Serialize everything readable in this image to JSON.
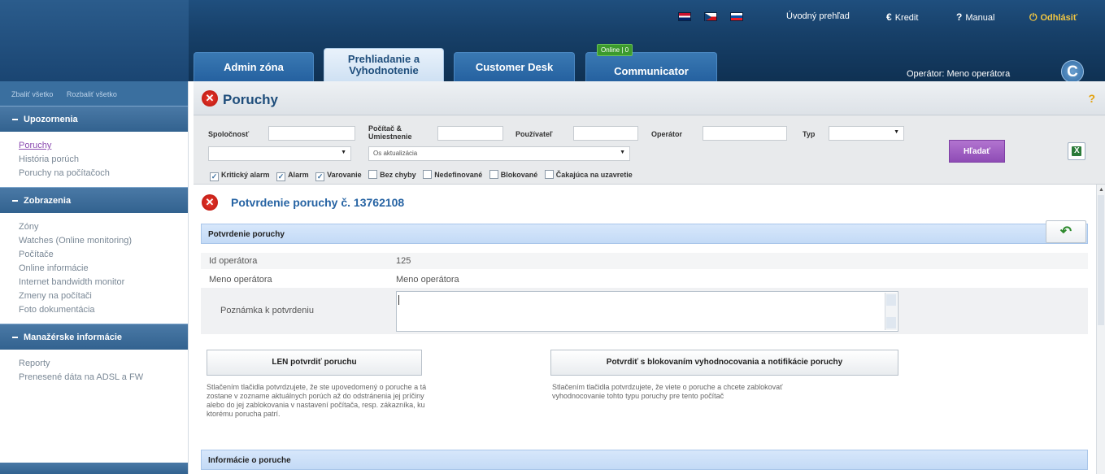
{
  "header": {
    "flags": [
      "uk-flag",
      "cz-flag",
      "sk-flag"
    ],
    "links": {
      "overview": "Úvodný prehľad",
      "credit_icon": "€",
      "credit": "Kredit",
      "manual_icon": "?",
      "manual": "Manual",
      "logout_icon": "⏻",
      "logout": "Odhlásiť"
    },
    "tabs": [
      {
        "label": "Admin zóna"
      },
      {
        "label_line1": "Prehliadanie a",
        "label_line2": "Vyhodnotenie"
      },
      {
        "label": "Customer Desk"
      },
      {
        "label": "Communicator"
      }
    ],
    "online_badge": "Online | 0",
    "operator_label": "Operátor: Meno operátora",
    "logo_letter": "C"
  },
  "sidebar": {
    "collapse_all": "Zbaliť všetko",
    "expand_all": "Rozbaliť všetko",
    "sections": [
      {
        "title": "Upozornenia",
        "items": [
          "Poruchy",
          "História porúch",
          "Poruchy na počítačoch"
        ]
      },
      {
        "title": "Zobrazenia",
        "items": [
          "Zóny",
          "Watches (Online monitoring)",
          "Počítače",
          "Online informácie",
          "Internet bandwidth monitor",
          "Zmeny na počítači",
          "Foto dokumentácia"
        ]
      },
      {
        "title": "Manažérske informácie",
        "items": [
          "Reporty",
          "Prenesené dáta na ADSL a FW"
        ]
      }
    ]
  },
  "page": {
    "title": "Poruchy",
    "help": "?"
  },
  "filter": {
    "company_label": "Spoločnosť",
    "computer_label_1": "Počítač &",
    "computer_label_2": "Umiestnenie",
    "user_label": "Používateľ",
    "operator_label": "Operátor",
    "type_label": "Typ",
    "time_select": "Os aktualizácia",
    "search_button": "Hľadať",
    "checkboxes": [
      {
        "label": "Kritický alarm",
        "checked": true
      },
      {
        "label": "Alarm",
        "checked": true
      },
      {
        "label": "Varovanie",
        "checked": true
      },
      {
        "label": "Bez chyby",
        "checked": false
      },
      {
        "label": "Nedefinované",
        "checked": false
      },
      {
        "label": "Blokované",
        "checked": false
      },
      {
        "label": "Čakajúca na uzavretie",
        "checked": false
      }
    ]
  },
  "detail": {
    "title": "Potvrdenie poruchy č. 13762108",
    "section_confirm": "Potvrdenie poruchy",
    "operator_id_label": "Id operátora",
    "operator_id_value": "125",
    "operator_name_label": "Meno operátora",
    "operator_name_value": "Meno operátora",
    "note_label": "Poznámka k potvrdeniu",
    "btn_confirm_only": "LEN potvrdiť poruchu",
    "btn_confirm_block": "Potvrdiť s blokovaním vyhodnocovania a notifikácie poruchy",
    "desc_confirm_only_1": "Stlačením tlačidla potvrdzujete, že ste upovedomený o poruche a tá",
    "desc_confirm_only_2": "zostane v zozname aktuálnych porúch až do odstránenia jej príčiny",
    "desc_confirm_only_3": "alebo do jej zablokovania v nastavení počítača, resp. zákazníka, ku",
    "desc_confirm_only_4": "ktorému porucha patrí.",
    "desc_confirm_block_1": "Stlačením tlačidla potvrdzujete, že viete o poruche a chcete zablokovať",
    "desc_confirm_block_2": "vyhodnocovanie tohto typu poruchy pre tento počítač",
    "section_info": "Informácie o poruche"
  }
}
